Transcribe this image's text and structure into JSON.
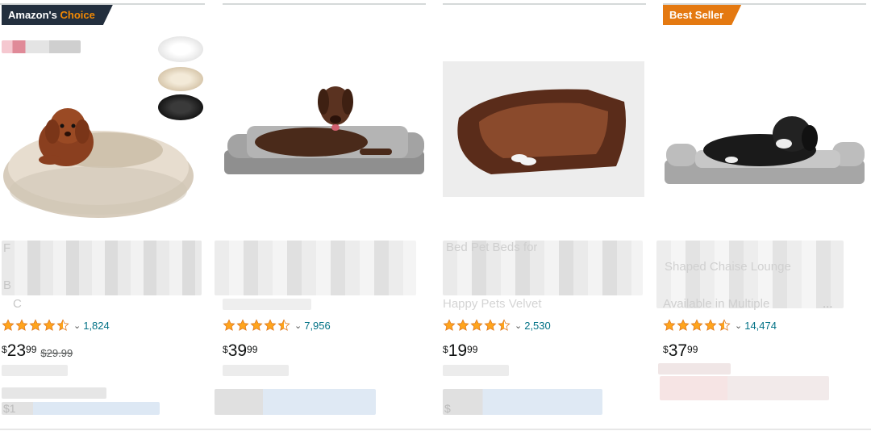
{
  "cards": [
    {
      "badge": {
        "text": "Amazon's ",
        "accent": "Choice"
      },
      "title_visible": "F",
      "title_line2": "B",
      "title_line3": "C",
      "rating_count": "1,824",
      "price": {
        "currency": "$",
        "whole": "23",
        "fraction": "99",
        "list_price": "$29.99"
      },
      "shipping_line": "$1",
      "image": "donut-dog-bed",
      "colors": [
        "#f2f2f2",
        "#e9dfcf",
        "#1f1f1f"
      ]
    },
    {
      "rating_count": "7,956",
      "price": {
        "currency": "$",
        "whole": "39",
        "fraction": "99"
      },
      "image": "orthopedic-sofa-bed-gray"
    },
    {
      "title_line1": "Bed Pet Beds for",
      "title_line4": "Happy Pets Velvet",
      "rating_count": "2,530",
      "price": {
        "currency": "$",
        "whole": "19",
        "fraction": "99"
      },
      "shipping_line": "$",
      "image": "rectangular-dog-bed-brown"
    },
    {
      "badge": {
        "text": "Best Seller"
      },
      "title_line2": "Shaped Chaise Lounge",
      "title_line4": "Available in Multiple",
      "title_ellipsis": "...",
      "rating_count": "14,474",
      "price": {
        "currency": "$",
        "whole": "37",
        "fraction": "99"
      },
      "image": "chaise-lounge-dog-bed"
    }
  ],
  "ui": {
    "star_color": "#ffa41c",
    "link_color": "#007185",
    "badge_choice_color": "#232f3e",
    "badge_seller_color": "#e47911",
    "chevron_glyph": "⌄"
  }
}
